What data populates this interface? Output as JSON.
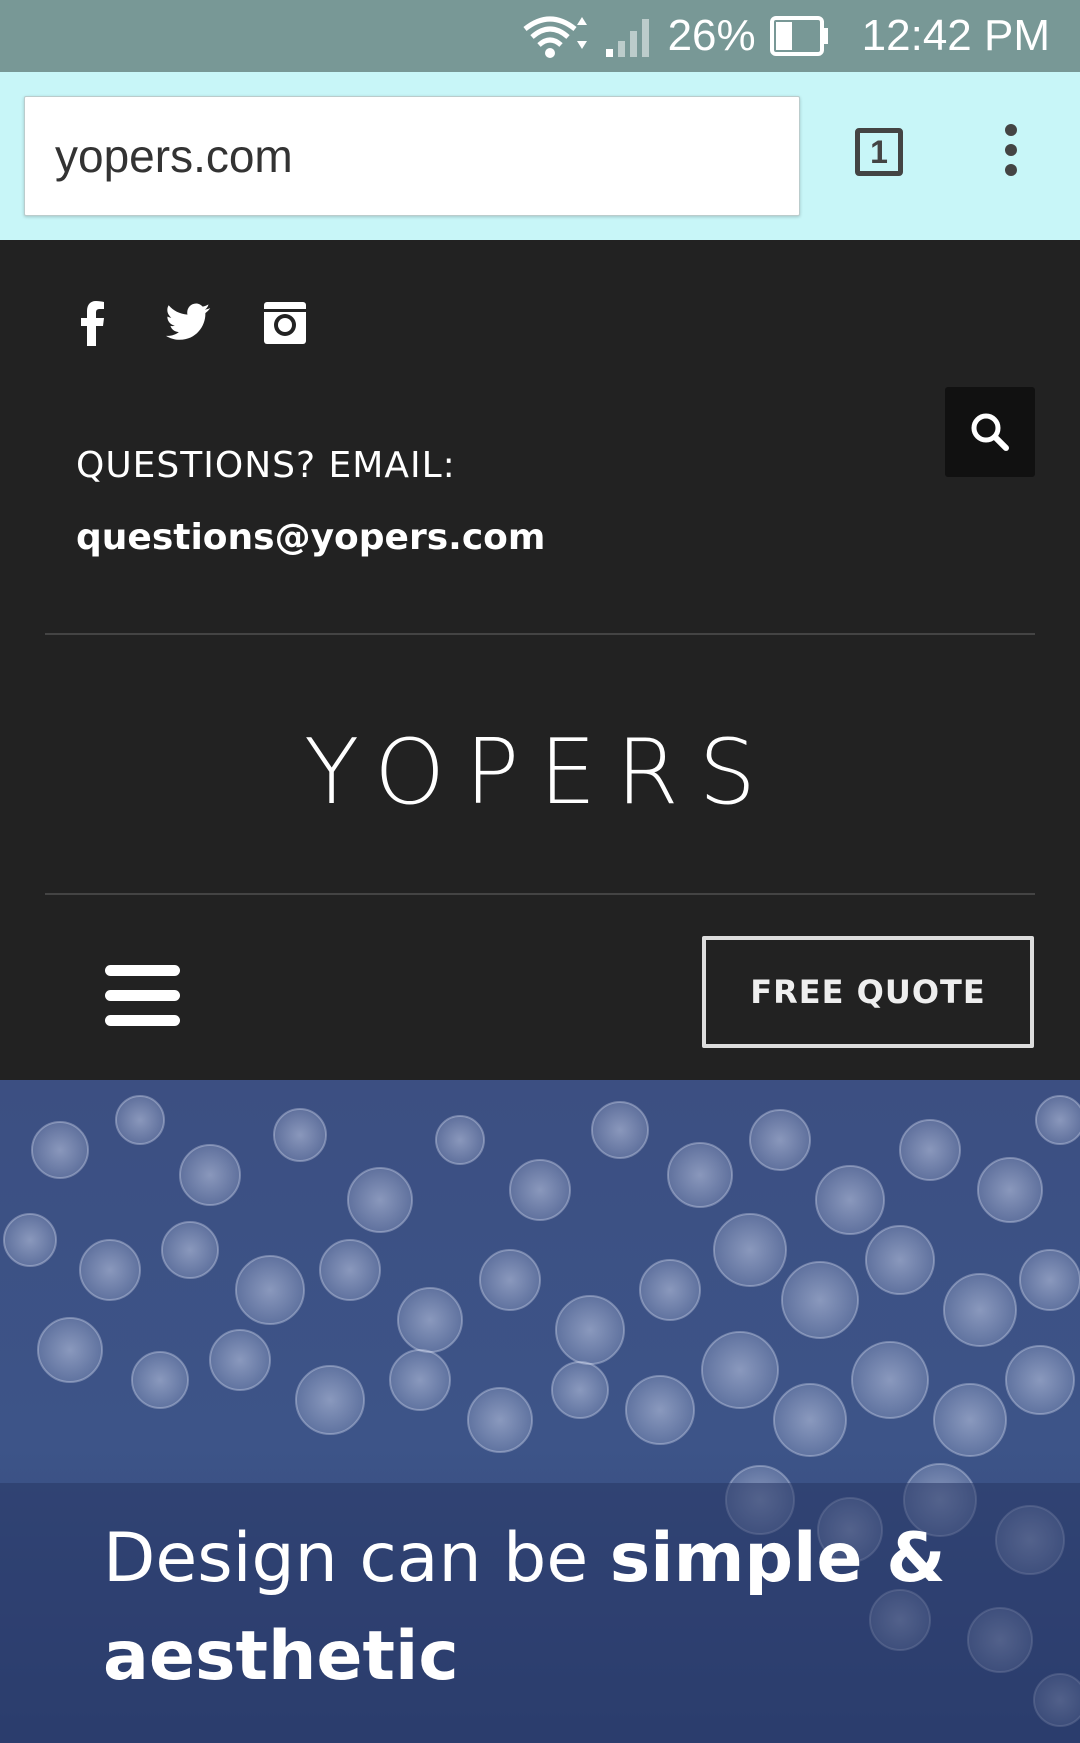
{
  "status_bar": {
    "battery": "26%",
    "time": "12:42 PM"
  },
  "browser": {
    "url": "yopers.com",
    "tab_count": "1"
  },
  "header": {
    "social_icons": [
      "facebook-icon",
      "twitter-icon",
      "instagram-icon"
    ],
    "questions_label": "QUESTIONS? EMAIL:",
    "email": "questions@yopers.com",
    "logo": "YOPERS",
    "free_quote_label": "FREE QUOTE"
  },
  "hero": {
    "title_regular": "Design can be",
    "title_bold": "simple & aesthetic"
  },
  "colors": {
    "status_bar": "#789896",
    "browser_bar": "#c8f6f8",
    "header_bg": "#222222",
    "hero_bg": "#3c4f82"
  }
}
